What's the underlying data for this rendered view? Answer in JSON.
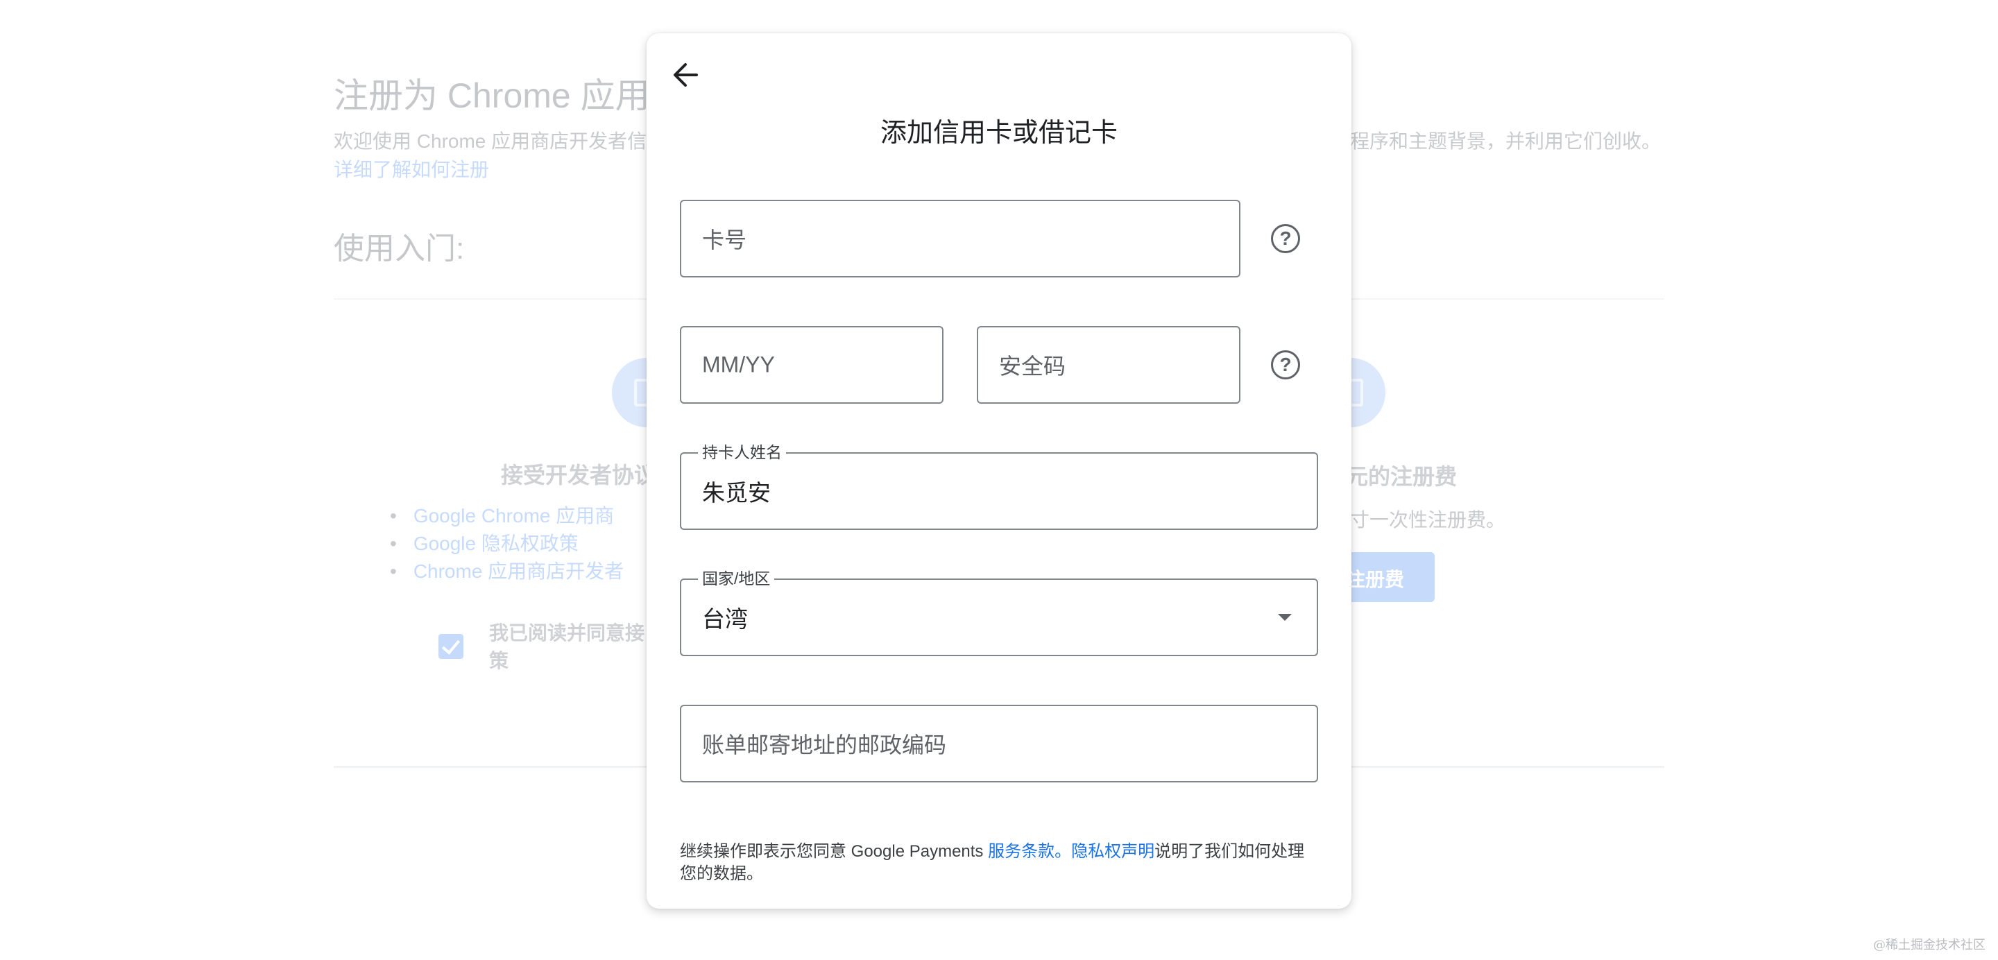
{
  "background": {
    "title": "注册为 Chrome 应用商",
    "intro_left": "欢迎使用 Chrome 应用商店开发者信",
    "intro_right": "程序和主题背景，并利用它们创收。",
    "learn_link": "详细了解如何注册",
    "getting_started": "使用入门:",
    "step1_title": "接受开发者协议",
    "step1_links": [
      "Google Chrome 应用商",
      "Google 隐私权政策",
      "Chrome 应用商店开发者"
    ],
    "agree_text": "我已阅读并同意接 策",
    "step2_title": "元的注册费",
    "step2_text": "寸一次性注册费。",
    "pay_button": "注册费"
  },
  "dialog": {
    "title": "添加信用卡或借记卡",
    "card_number_placeholder": "卡号",
    "expiry_placeholder": "MM/YY",
    "security_code_placeholder": "安全码",
    "cardholder_label": "持卡人姓名",
    "cardholder_value": "朱觅安",
    "country_label": "国家/地区",
    "country_value": "台湾",
    "postal_code_placeholder": "账单邮寄地址的邮政编码",
    "help_glyph": "?",
    "legal": {
      "prefix": "继续操作即表示您同意 Google Payments ",
      "terms_link": "服务条款",
      "separator": "。",
      "privacy_link": "隐私权声明",
      "suffix": "说明了我们如何处理您的数据。"
    }
  },
  "watermark": "@稀土掘金技术社区",
  "colors": {
    "accent": "#1a73e8",
    "outline": "#80868b",
    "dim_link": "#c6dafc"
  },
  "icons": {
    "back": "arrow-left-icon",
    "help": "help-circle-icon",
    "dropdown": "caret-down-icon"
  }
}
